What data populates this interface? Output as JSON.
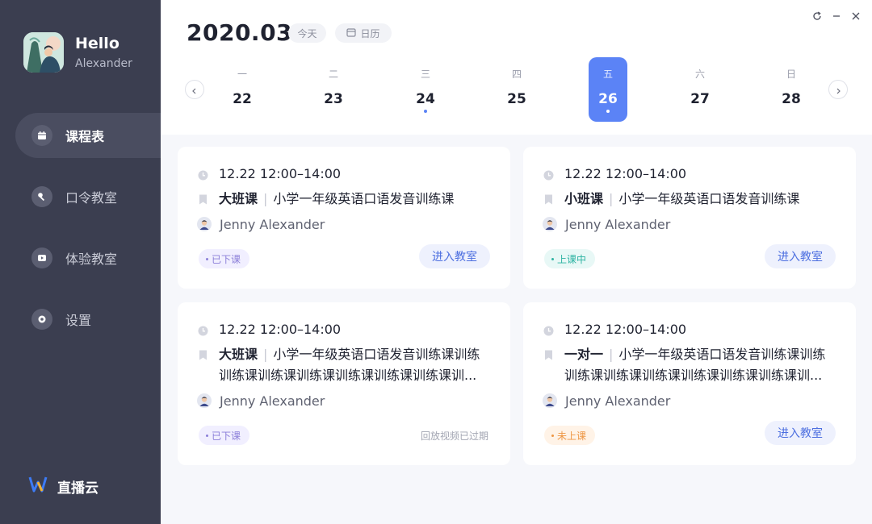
{
  "user": {
    "greeting": "Hello",
    "name": "Alexander"
  },
  "nav": [
    {
      "label": "课程表",
      "active": true
    },
    {
      "label": "口令教室"
    },
    {
      "label": "体验教室"
    },
    {
      "label": "设置"
    }
  ],
  "brand": {
    "label": "直播云"
  },
  "header": {
    "year_month": "2020.03",
    "today_label": "今天",
    "calendar_label": "日历"
  },
  "week": [
    {
      "weekday": "一",
      "date": "22",
      "has_class": false,
      "selected": false
    },
    {
      "weekday": "二",
      "date": "23",
      "has_class": false,
      "selected": false
    },
    {
      "weekday": "三",
      "date": "24",
      "has_class": true,
      "selected": false
    },
    {
      "weekday": "四",
      "date": "25",
      "has_class": false,
      "selected": false
    },
    {
      "weekday": "五",
      "date": "26",
      "has_class": true,
      "selected": true
    },
    {
      "weekday": "六",
      "date": "27",
      "has_class": false,
      "selected": false
    },
    {
      "weekday": "日",
      "date": "28",
      "has_class": false,
      "selected": false
    }
  ],
  "courses": [
    {
      "time": "12.22 12:00–14:00",
      "type": "大班课",
      "title": "小学一年级英语口语发音训练课",
      "teacher": "Jenny Alexander",
      "status": "已下课",
      "action": "进入教室"
    },
    {
      "time": "12.22 12:00–14:00",
      "type": "小班课",
      "title": "小学一年级英语口语发音训练课",
      "teacher": "Jenny Alexander",
      "status": "上课中",
      "action": "进入教室"
    },
    {
      "time": "12.22 12:00–14:00",
      "type": "大班课",
      "title": "小学一年级英语口语发音训练课训练",
      "title_line2": "训练课训练课训练课训练课训练课训练课训...",
      "teacher": "Jenny Alexander",
      "status": "已下课",
      "note": "回放视频已过期"
    },
    {
      "time": "12.22 12:00–14:00",
      "type": "一对一",
      "title": "小学一年级英语口语发音训练课训练",
      "title_line2": "训练课训练课训练课训练课训练课训练课训...",
      "teacher": "Jenny Alexander",
      "status": "未上课",
      "action": "进入教室"
    }
  ],
  "colors": {
    "sidebar": "#3b3e50",
    "accent": "#5b83f6",
    "done": "#8c7fd9",
    "live": "#2db3a2",
    "pending": "#ee9643"
  }
}
